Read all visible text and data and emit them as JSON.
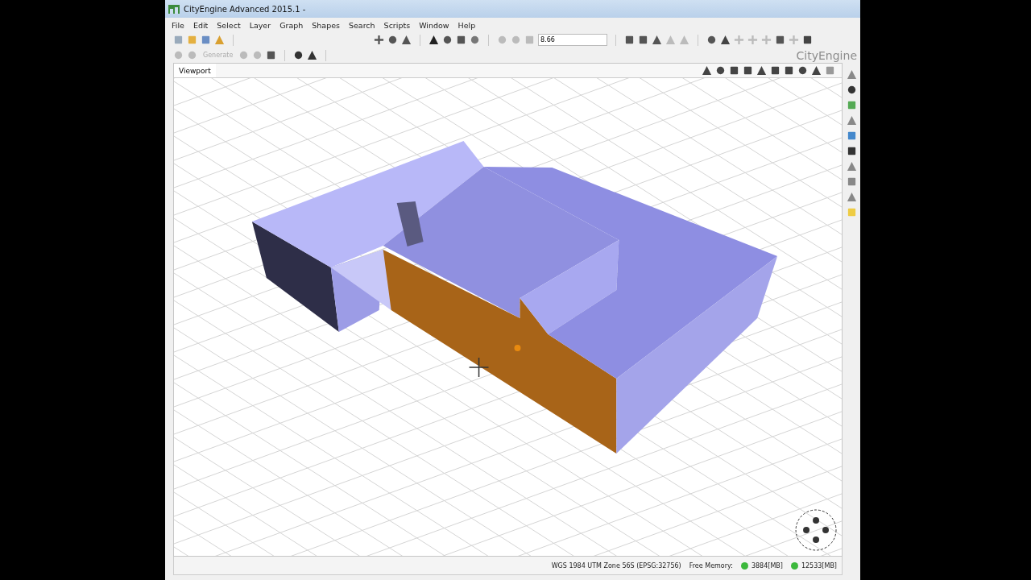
{
  "window": {
    "title": "CityEngine Advanced 2015.1 -"
  },
  "menu": [
    "File",
    "Edit",
    "Select",
    "Layer",
    "Graph",
    "Shapes",
    "Search",
    "Scripts",
    "Window",
    "Help"
  ],
  "toolbar": {
    "zoom_field": {
      "value": "8.66"
    },
    "generate_button": {
      "label": "Generate",
      "disabled": true
    },
    "logo": "CityEngine"
  },
  "tabs": [
    {
      "label": "Viewport",
      "selected": true
    }
  ],
  "status_bar": {
    "coordinate_system": "WGS 1984 UTM Zone 56S (EPSG:32756)",
    "memory_label": "Free Memory:",
    "memory": [
      "3884[MB]",
      "12533[MB]"
    ]
  }
}
